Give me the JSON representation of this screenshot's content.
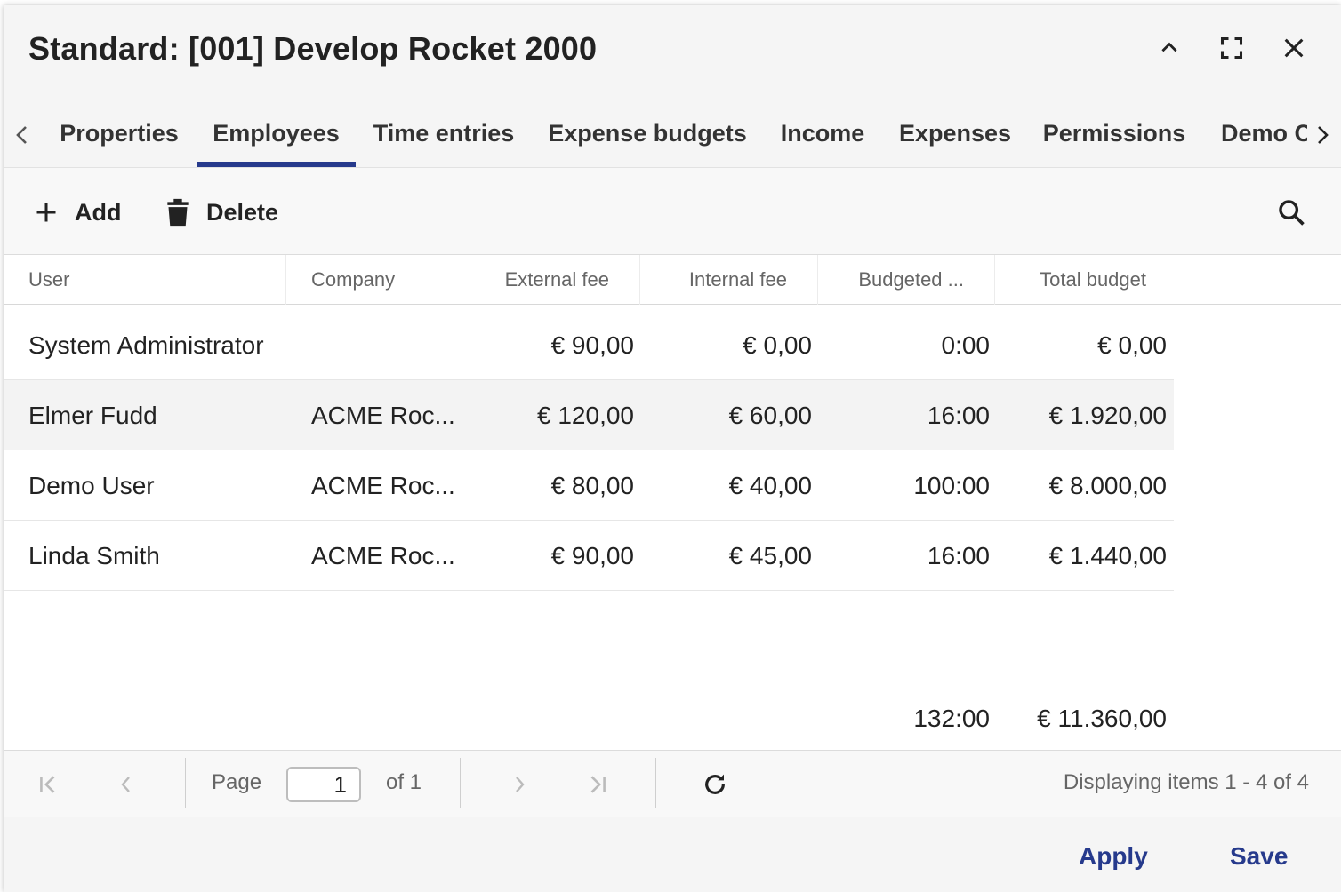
{
  "dialog": {
    "title": "Standard: [001] Develop Rocket 2000"
  },
  "tabs": [
    {
      "label": "Properties",
      "active": false
    },
    {
      "label": "Employees",
      "active": true
    },
    {
      "label": "Time entries",
      "active": false
    },
    {
      "label": "Expense budgets",
      "active": false
    },
    {
      "label": "Income",
      "active": false
    },
    {
      "label": "Expenses",
      "active": false
    },
    {
      "label": "Permissions",
      "active": false
    },
    {
      "label": "Demo C",
      "active": false
    }
  ],
  "toolbar": {
    "add_label": "Add",
    "delete_label": "Delete"
  },
  "grid": {
    "columns": [
      "User",
      "Company",
      "External fee",
      "Internal fee",
      "Budgeted ...",
      "Total budget"
    ],
    "rows": [
      {
        "user": "System Administrator",
        "company": "",
        "external_fee": "€ 90,00",
        "internal_fee": "€ 0,00",
        "budgeted": "0:00",
        "total_budget": "€ 0,00",
        "selected": false
      },
      {
        "user": "Elmer Fudd",
        "company": "ACME Roc...",
        "external_fee": "€ 120,00",
        "internal_fee": "€ 60,00",
        "budgeted": "16:00",
        "total_budget": "€ 1.920,00",
        "selected": true
      },
      {
        "user": "Demo User",
        "company": "ACME Roc...",
        "external_fee": "€ 80,00",
        "internal_fee": "€ 40,00",
        "budgeted": "100:00",
        "total_budget": "€ 8.000,00",
        "selected": false
      },
      {
        "user": "Linda Smith",
        "company": "ACME Roc...",
        "external_fee": "€ 90,00",
        "internal_fee": "€ 45,00",
        "budgeted": "16:00",
        "total_budget": "€ 1.440,00",
        "selected": false
      }
    ],
    "summary": {
      "budgeted": "132:00",
      "total_budget": "€ 11.360,00"
    }
  },
  "pager": {
    "page_label": "Page",
    "page_value": "1",
    "of_label": "of 1",
    "info": "Displaying items 1 - 4 of 4"
  },
  "footer": {
    "apply_label": "Apply",
    "save_label": "Save"
  },
  "colors": {
    "accent": "#263a8c",
    "selected_row": "#f3f3f3"
  }
}
